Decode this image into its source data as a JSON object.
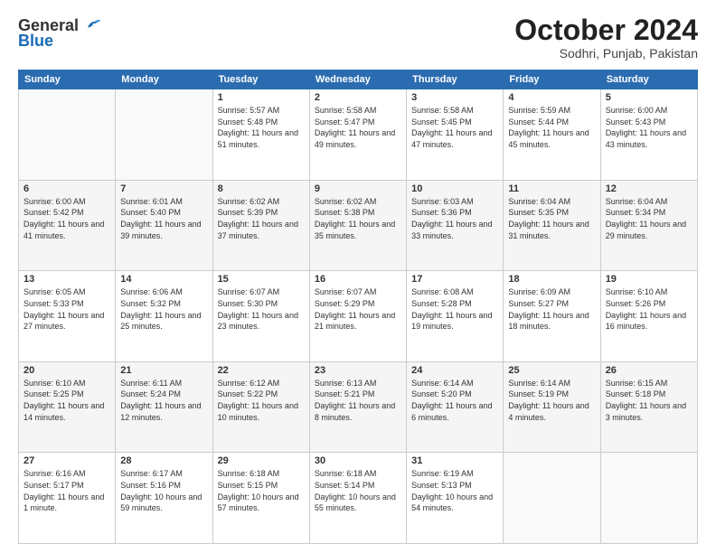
{
  "header": {
    "logo_general": "General",
    "logo_blue": "Blue",
    "title": "October 2024",
    "subtitle": "Sodhri, Punjab, Pakistan"
  },
  "days_of_week": [
    "Sunday",
    "Monday",
    "Tuesday",
    "Wednesday",
    "Thursday",
    "Friday",
    "Saturday"
  ],
  "weeks": [
    [
      {
        "day": "",
        "info": ""
      },
      {
        "day": "",
        "info": ""
      },
      {
        "day": "1",
        "info": "Sunrise: 5:57 AM\nSunset: 5:48 PM\nDaylight: 11 hours and 51 minutes."
      },
      {
        "day": "2",
        "info": "Sunrise: 5:58 AM\nSunset: 5:47 PM\nDaylight: 11 hours and 49 minutes."
      },
      {
        "day": "3",
        "info": "Sunrise: 5:58 AM\nSunset: 5:45 PM\nDaylight: 11 hours and 47 minutes."
      },
      {
        "day": "4",
        "info": "Sunrise: 5:59 AM\nSunset: 5:44 PM\nDaylight: 11 hours and 45 minutes."
      },
      {
        "day": "5",
        "info": "Sunrise: 6:00 AM\nSunset: 5:43 PM\nDaylight: 11 hours and 43 minutes."
      }
    ],
    [
      {
        "day": "6",
        "info": "Sunrise: 6:00 AM\nSunset: 5:42 PM\nDaylight: 11 hours and 41 minutes."
      },
      {
        "day": "7",
        "info": "Sunrise: 6:01 AM\nSunset: 5:40 PM\nDaylight: 11 hours and 39 minutes."
      },
      {
        "day": "8",
        "info": "Sunrise: 6:02 AM\nSunset: 5:39 PM\nDaylight: 11 hours and 37 minutes."
      },
      {
        "day": "9",
        "info": "Sunrise: 6:02 AM\nSunset: 5:38 PM\nDaylight: 11 hours and 35 minutes."
      },
      {
        "day": "10",
        "info": "Sunrise: 6:03 AM\nSunset: 5:36 PM\nDaylight: 11 hours and 33 minutes."
      },
      {
        "day": "11",
        "info": "Sunrise: 6:04 AM\nSunset: 5:35 PM\nDaylight: 11 hours and 31 minutes."
      },
      {
        "day": "12",
        "info": "Sunrise: 6:04 AM\nSunset: 5:34 PM\nDaylight: 11 hours and 29 minutes."
      }
    ],
    [
      {
        "day": "13",
        "info": "Sunrise: 6:05 AM\nSunset: 5:33 PM\nDaylight: 11 hours and 27 minutes."
      },
      {
        "day": "14",
        "info": "Sunrise: 6:06 AM\nSunset: 5:32 PM\nDaylight: 11 hours and 25 minutes."
      },
      {
        "day": "15",
        "info": "Sunrise: 6:07 AM\nSunset: 5:30 PM\nDaylight: 11 hours and 23 minutes."
      },
      {
        "day": "16",
        "info": "Sunrise: 6:07 AM\nSunset: 5:29 PM\nDaylight: 11 hours and 21 minutes."
      },
      {
        "day": "17",
        "info": "Sunrise: 6:08 AM\nSunset: 5:28 PM\nDaylight: 11 hours and 19 minutes."
      },
      {
        "day": "18",
        "info": "Sunrise: 6:09 AM\nSunset: 5:27 PM\nDaylight: 11 hours and 18 minutes."
      },
      {
        "day": "19",
        "info": "Sunrise: 6:10 AM\nSunset: 5:26 PM\nDaylight: 11 hours and 16 minutes."
      }
    ],
    [
      {
        "day": "20",
        "info": "Sunrise: 6:10 AM\nSunset: 5:25 PM\nDaylight: 11 hours and 14 minutes."
      },
      {
        "day": "21",
        "info": "Sunrise: 6:11 AM\nSunset: 5:24 PM\nDaylight: 11 hours and 12 minutes."
      },
      {
        "day": "22",
        "info": "Sunrise: 6:12 AM\nSunset: 5:22 PM\nDaylight: 11 hours and 10 minutes."
      },
      {
        "day": "23",
        "info": "Sunrise: 6:13 AM\nSunset: 5:21 PM\nDaylight: 11 hours and 8 minutes."
      },
      {
        "day": "24",
        "info": "Sunrise: 6:14 AM\nSunset: 5:20 PM\nDaylight: 11 hours and 6 minutes."
      },
      {
        "day": "25",
        "info": "Sunrise: 6:14 AM\nSunset: 5:19 PM\nDaylight: 11 hours and 4 minutes."
      },
      {
        "day": "26",
        "info": "Sunrise: 6:15 AM\nSunset: 5:18 PM\nDaylight: 11 hours and 3 minutes."
      }
    ],
    [
      {
        "day": "27",
        "info": "Sunrise: 6:16 AM\nSunset: 5:17 PM\nDaylight: 11 hours and 1 minute."
      },
      {
        "day": "28",
        "info": "Sunrise: 6:17 AM\nSunset: 5:16 PM\nDaylight: 10 hours and 59 minutes."
      },
      {
        "day": "29",
        "info": "Sunrise: 6:18 AM\nSunset: 5:15 PM\nDaylight: 10 hours and 57 minutes."
      },
      {
        "day": "30",
        "info": "Sunrise: 6:18 AM\nSunset: 5:14 PM\nDaylight: 10 hours and 55 minutes."
      },
      {
        "day": "31",
        "info": "Sunrise: 6:19 AM\nSunset: 5:13 PM\nDaylight: 10 hours and 54 minutes."
      },
      {
        "day": "",
        "info": ""
      },
      {
        "day": "",
        "info": ""
      }
    ]
  ]
}
